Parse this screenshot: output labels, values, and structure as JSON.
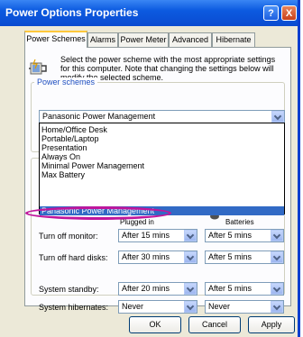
{
  "window": {
    "title": "Power Options Properties",
    "help_glyph": "?",
    "close_glyph": "X"
  },
  "tabs": [
    {
      "label": "Power Schemes",
      "active": true
    },
    {
      "label": "Alarms",
      "active": false
    },
    {
      "label": "Power Meter",
      "active": false
    },
    {
      "label": "Advanced",
      "active": false
    },
    {
      "label": "Hibernate",
      "active": false
    }
  ],
  "intro_text": "Select the power scheme with the most appropriate settings for this computer. Note that changing the settings below will modify the selected scheme.",
  "power_schemes": {
    "group_label": "Power schemes",
    "current": "Panasonic Power Management",
    "options": [
      "Home/Office Desk",
      "Portable/Laptop",
      "Presentation",
      "Always On",
      "Minimal Power Management",
      "Max Battery",
      "Panasonic Power Management"
    ],
    "selected_index": 6
  },
  "settings": {
    "col_plugged": "Plugged in",
    "col_batteries": "Batteries",
    "rows": [
      {
        "label": "Turn off monitor:",
        "plugged": "After 15 mins",
        "batteries": "After 5 mins"
      },
      {
        "label": "Turn off hard disks:",
        "plugged": "After 30 mins",
        "batteries": "After 5 mins"
      },
      {
        "label": "System standby:",
        "plugged": "After 20 mins",
        "batteries": "After 5 mins"
      },
      {
        "label": "System hibernates:",
        "plugged": "Never",
        "batteries": "Never"
      }
    ]
  },
  "buttons": {
    "ok": "OK",
    "cancel": "Cancel",
    "apply": "Apply"
  },
  "colors": {
    "titlebar": "#0a4bd0",
    "highlight": "#316ac5",
    "annotation": "#c0169c"
  }
}
